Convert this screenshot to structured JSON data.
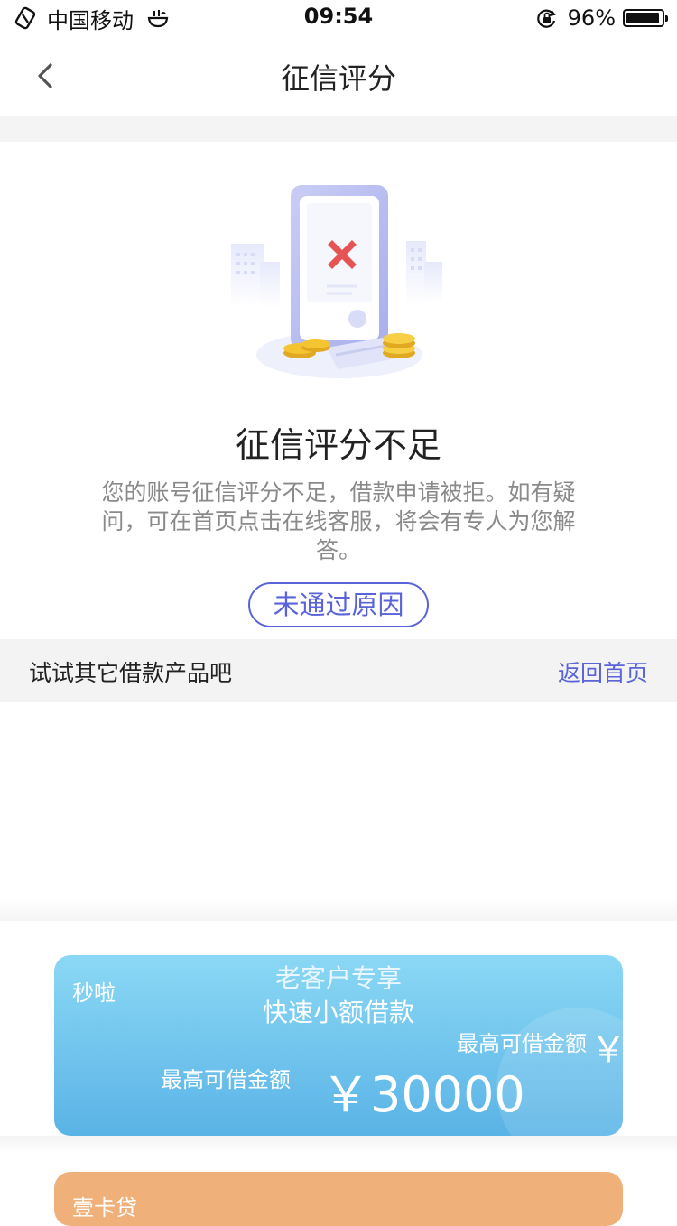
{
  "status_bar": {
    "carrier": "中国移动",
    "time": "09:54",
    "battery": "96%",
    "battery_level": 0.96
  },
  "nav": {
    "title": "征信评分"
  },
  "result": {
    "headline": "征信评分不足",
    "description": "您的账号征信评分不足，借款申请被拒。如有疑问，可在首页点击在线客服，将会有专人为您解答。",
    "reason_button": "未通过原因"
  },
  "section": {
    "title": "试试其它借款产品吧",
    "home_link": "返回首页"
  },
  "products": [
    {
      "brand": "秒啦",
      "line1": "老客户专享",
      "line2": "快速小额借款",
      "max_label": "最高可借金额",
      "amount": "￥30000",
      "max_label_2": "最高可借金额",
      "amount_2": "￥",
      "color": "#6cc3ec"
    },
    {
      "brand": "壹卡贷",
      "color": "#f0b07a"
    }
  ],
  "colors": {
    "accent": "#5a63d8",
    "error": "#e55353",
    "coin": "#f5c531"
  }
}
